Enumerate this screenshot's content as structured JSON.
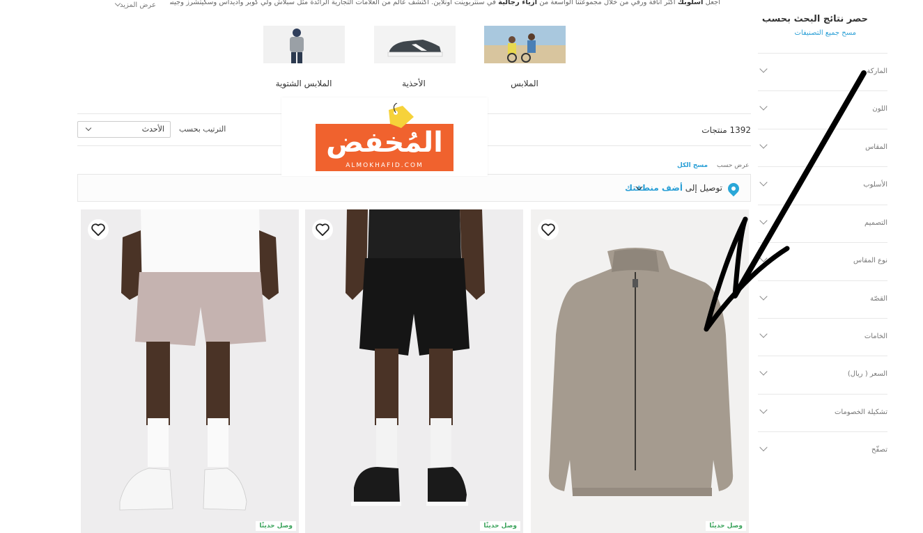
{
  "intro": {
    "text_pre": "اجعل ",
    "bold1": "اسلوبك",
    "text_mid": " اكثر اناقة ورقي من خلال مجموعتنا الواسعة من ",
    "bold2": "ازياء رجالية",
    "text_post": " في سنتربوينت اونلاين. اكتشف عالم من العلامات التجارية الرائدة مثل سبلاش ولي كوبر واديداس وسكيتشرز وجيس وغي...",
    "show_more": "عرض المزيد"
  },
  "categories": [
    {
      "label": "الملابس",
      "image": "clothes-photo"
    },
    {
      "label": "الأحذية",
      "image": "shoe-photo"
    },
    {
      "label": "الملابس الشتوية",
      "image": "winter-wear-photo"
    }
  ],
  "sidebar": {
    "title": "حصر نتائج البحث بحسب",
    "clear": "مسح جميع التصنيفات",
    "filters": [
      "الماركة",
      "اللون",
      "المقاس",
      "الأسلوب",
      "التصميم",
      "نوع المقاس",
      "القصّة",
      "الخامات",
      "السعر ( ريال)",
      "تشكيلة الخصومات",
      "تصفّح"
    ]
  },
  "toolbar": {
    "count": "1392 منتجات",
    "sort_label": "الترتيب بحسب",
    "sort_value": "الأحدث",
    "view_by": "عرض حسب",
    "clear_all": "مسح الكل"
  },
  "delivery": {
    "prefix": "توصيل إلى ",
    "link": "أضف منطقتك"
  },
  "products": [
    {
      "badge": "وصل حديثًا",
      "image": "jacket-photo"
    },
    {
      "badge": "وصل حديثًا",
      "image": "black-shorts-photo"
    },
    {
      "badge": "وصل حديثًا",
      "image": "beige-shorts-photo"
    }
  ],
  "logo": {
    "word": "المُخفض",
    "sub": "ALMOKHAFID.COM"
  },
  "colors": {
    "accent": "#2a9fd6",
    "badge": "#3aa35b",
    "logo": "#f0622e"
  }
}
